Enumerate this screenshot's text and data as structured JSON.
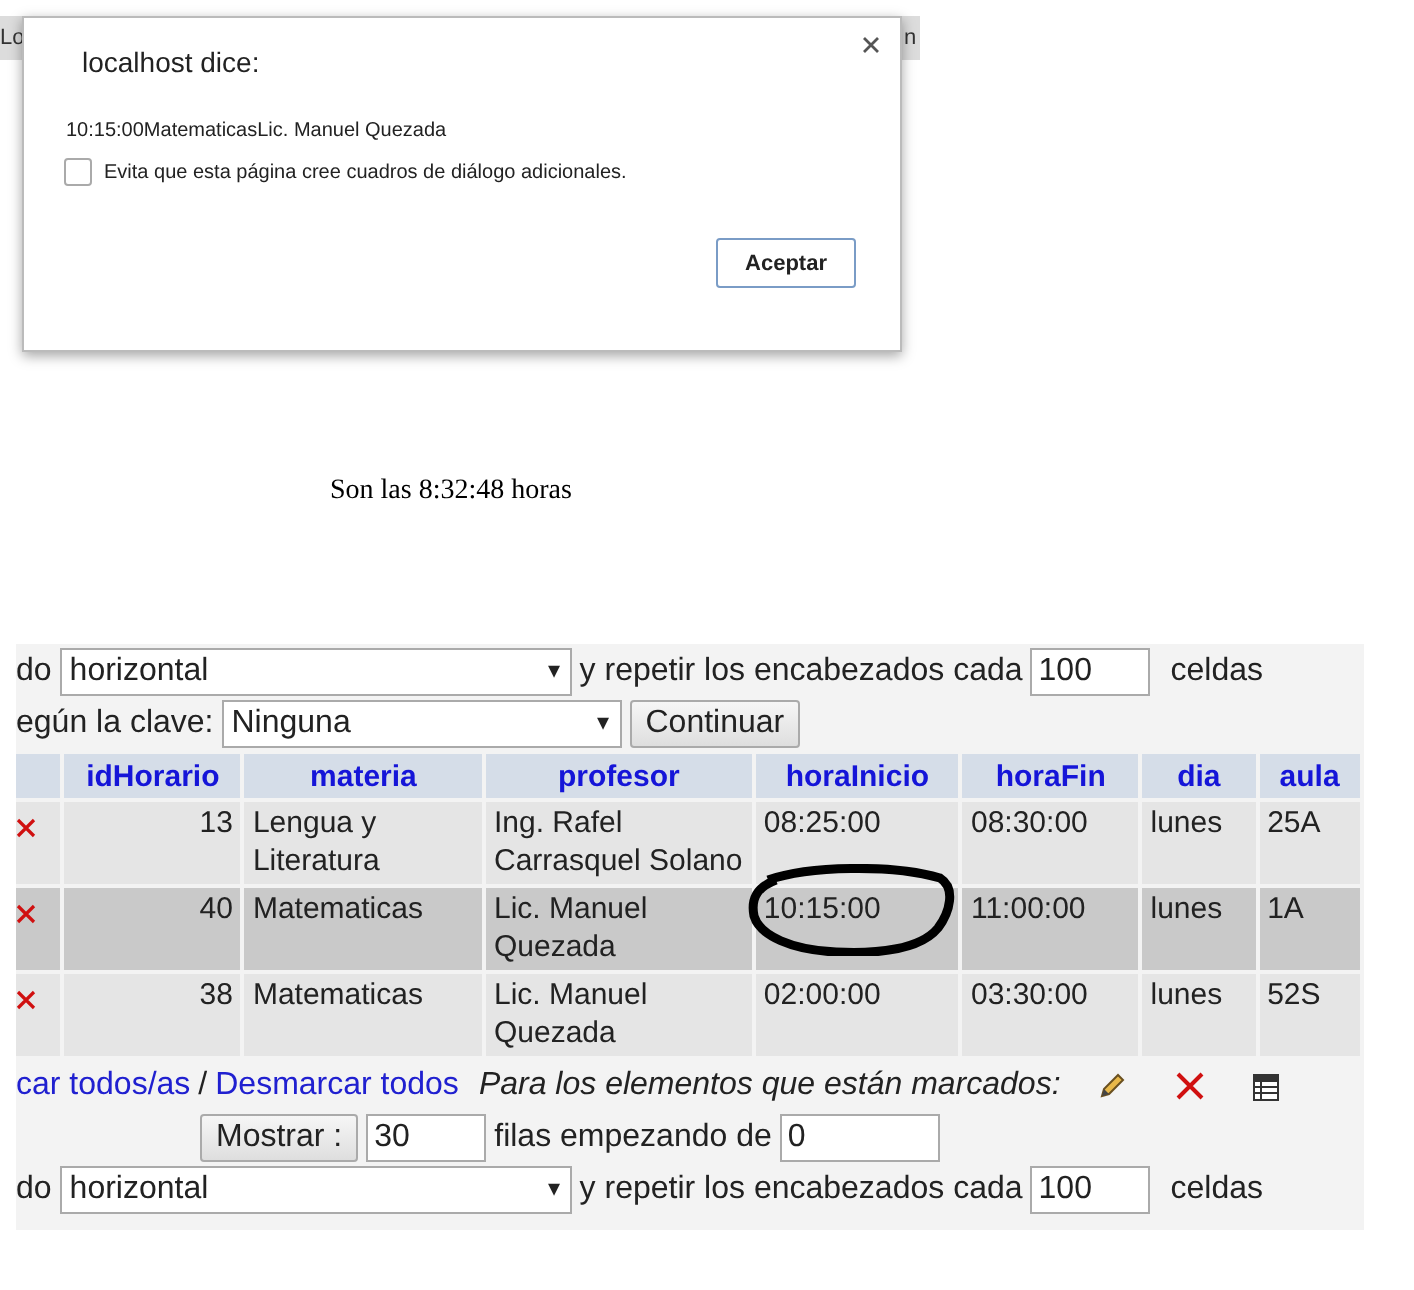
{
  "browser_tabs": {
    "left": "Lo",
    "right": "n"
  },
  "dialog": {
    "title": "localhost dice:",
    "message": "10:15:00MatematicasLic. Manuel Quezada",
    "checkbox": {
      "label": "Evita que esta página cree cuadros de diálogo adicionales.",
      "checked": false
    },
    "button": "Aceptar"
  },
  "clock": "Son las 8:32:48 horas",
  "dropdown_arrow": "▾",
  "display_top": {
    "label": "do",
    "mode": "horizontal",
    "repeat_label": "y repetir los encabezados cada",
    "repeat_value": "100",
    "unit": "celdas"
  },
  "sort": {
    "label": "egún la clave:",
    "value": "Ninguna",
    "button": "Continuar"
  },
  "table": {
    "columns": [
      "idHorario",
      "materia",
      "profesor",
      "horaInicio",
      "horaFin",
      "dia",
      "aula"
    ],
    "rows": [
      {
        "highlighted": false,
        "cells": [
          "13",
          "Lengua y Literatura",
          "Ing. Rafel Carrasquel Solano",
          "08:25:00",
          "08:30:00",
          "lunes",
          "25A"
        ]
      },
      {
        "highlighted": true,
        "cells": [
          "40",
          "Matematicas",
          "Lic. Manuel Quezada",
          "10:15:00",
          "11:00:00",
          "lunes",
          "1A"
        ]
      },
      {
        "highlighted": false,
        "cells": [
          "38",
          "Matematicas",
          "Lic. Manuel Quezada",
          "02:00:00",
          "03:30:00",
          "lunes",
          "52S"
        ]
      }
    ]
  },
  "selection": {
    "check_all": "car todos/as",
    "separator": "/",
    "uncheck_all": "Desmarcar todos",
    "marked_label": "Para los elementos que están marcados:"
  },
  "paging": {
    "button": "Mostrar :",
    "rows": "30",
    "from_label": "filas empezando de",
    "from": "0"
  },
  "display_bottom": {
    "label": "do",
    "mode": "horizontal",
    "repeat_label": "y repetir los encabezados cada",
    "repeat_value": "100",
    "unit": "celdas"
  }
}
